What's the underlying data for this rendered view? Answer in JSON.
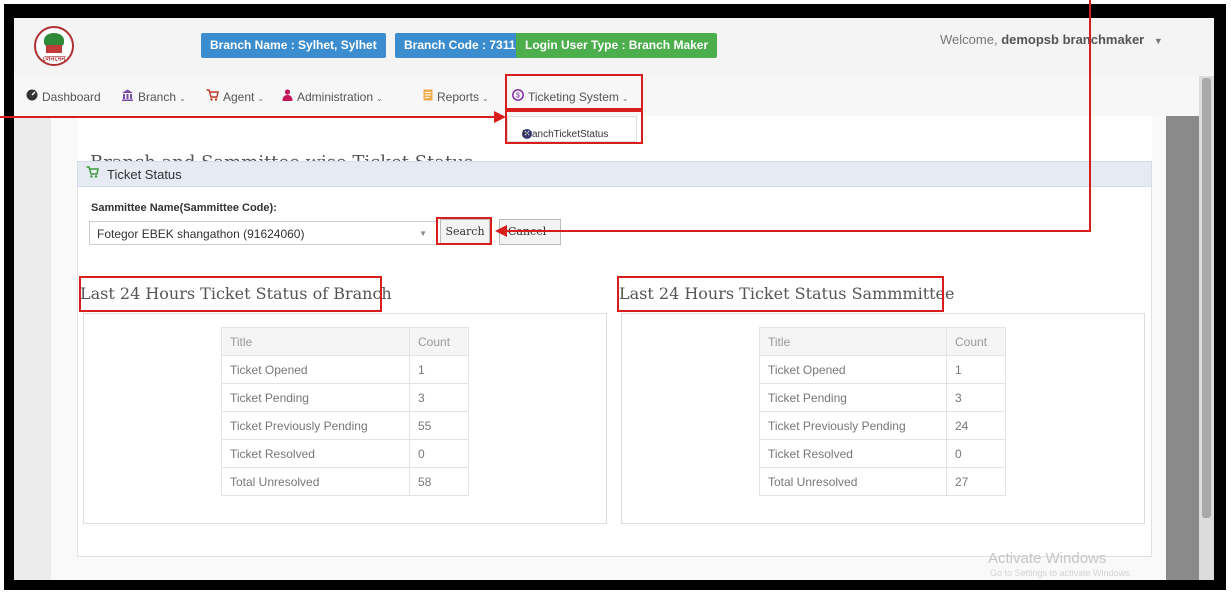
{
  "header": {
    "logo_text": "লেনদেন",
    "branch_name": "Branch Name : Sylhet, Sylhet",
    "branch_code": "Branch Code : 7311",
    "user_type": "Login User Type : Branch Maker",
    "welcome_prefix": "Welcome,",
    "username": "demopsb branchmaker",
    "user_caret": "▼"
  },
  "nav": {
    "items": [
      {
        "icon": "dashboard-icon",
        "label": "Dashboard"
      },
      {
        "icon": "bank-icon",
        "label": "Branch"
      },
      {
        "icon": "cart-icon",
        "label": "Agent"
      },
      {
        "icon": "admin-user-icon",
        "label": "Administration"
      },
      {
        "icon": "report-icon",
        "label": "Reports"
      },
      {
        "icon": "ticket-icon",
        "label": "Ticketing System"
      }
    ],
    "dropdown_caret": "⌄",
    "ticket_dropdown_item": "BranchTicketStatus"
  },
  "page": {
    "title": "Branch and Sammittee wise Ticket Status",
    "panel_title": "Ticket Status",
    "field_label": "Sammittee Name(Sammittee Code):",
    "select_value": "Fotegor EBEK shangathon (91624060)",
    "search_label": "Search",
    "cancel_label": "Cancel"
  },
  "branch_status": {
    "title": "Last 24 Hours Ticket Status of Branch",
    "headers": [
      "Title",
      "Count"
    ],
    "rows": [
      [
        "Ticket Opened",
        "1"
      ],
      [
        "Ticket Pending",
        "3"
      ],
      [
        "Ticket Previously Pending",
        "55"
      ],
      [
        "Ticket Resolved",
        "0"
      ],
      [
        "Total Unresolved",
        "58"
      ]
    ]
  },
  "sammittee_status": {
    "title": "Last 24 Hours Ticket Status Sammmittee",
    "headers": [
      "Title",
      "Count"
    ],
    "rows": [
      [
        "Ticket Opened",
        "1"
      ],
      [
        "Ticket Pending",
        "3"
      ],
      [
        "Ticket Previously Pending",
        "24"
      ],
      [
        "Ticket Resolved",
        "0"
      ],
      [
        "Total Unresolved",
        "27"
      ]
    ]
  },
  "watermark": {
    "line1": "Activate Windows",
    "line2": "Go to Settings to activate Windows."
  },
  "colors": {
    "highlight": "#d91c1c",
    "badge_blue": "#3b8dcf",
    "badge_green": "#4cae4c"
  }
}
